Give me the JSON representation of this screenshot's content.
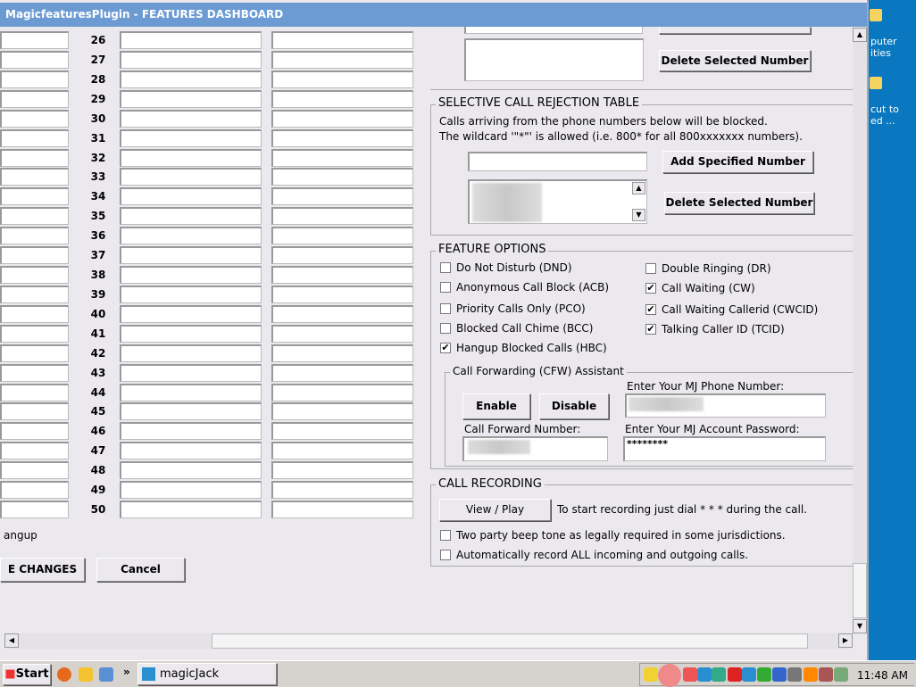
{
  "window": {
    "title": "MagicfeaturesPlugin - FEATURES DASHBOARD"
  },
  "table": {
    "row_numbers": [
      "26",
      "27",
      "28",
      "29",
      "30",
      "31",
      "32",
      "33",
      "34",
      "35",
      "36",
      "37",
      "38",
      "39",
      "40",
      "41",
      "42",
      "43",
      "44",
      "45",
      "46",
      "47",
      "48",
      "49",
      "50"
    ]
  },
  "left_footer": {
    "hangup_label": "angup",
    "save_label": "E CHANGES",
    "cancel_label": "Cancel"
  },
  "top_section": {
    "delete_label": "Delete Selected Number"
  },
  "rejection": {
    "title": "SELECTIVE CALL REJECTION TABLE",
    "line1": "Calls arriving from the phone numbers below will be blocked.",
    "line2": "The wildcard '\"*\"' is allowed (i.e. 800* for all 800xxxxxxx numbers).",
    "add_label": "Add Specified Number",
    "delete_label": "Delete Selected Number"
  },
  "features": {
    "title": "FEATURE OPTIONS",
    "left": [
      {
        "label": "Do Not Disturb (DND)",
        "checked": false
      },
      {
        "label": "Anonymous Call Block (ACB)",
        "checked": false
      },
      {
        "label": "Priority Calls Only (PCO)",
        "checked": false
      },
      {
        "label": "Blocked Call Chime (BCC)",
        "checked": false
      },
      {
        "label": "Hangup Blocked Calls (HBC)",
        "checked": true
      }
    ],
    "right": [
      {
        "label": "Double Ringing (DR)",
        "checked": false
      },
      {
        "label": "Call Waiting (CW)",
        "checked": true
      },
      {
        "label": "Call Waiting Callerid (CWCID)",
        "checked": true
      },
      {
        "label": "Talking Caller ID (TCID)",
        "checked": true
      }
    ]
  },
  "cfw": {
    "title": "Call Forwarding (CFW) Assistant",
    "enable": "Enable",
    "disable": "Disable",
    "phone_label": "Enter Your MJ Phone Number:",
    "forward_label": "Call Forward Number:",
    "password_label": "Enter Your MJ Account Password:",
    "password_value": "********"
  },
  "recording": {
    "title": "CALL RECORDING",
    "view_play": "View / Play",
    "hint": "To start recording just dial  * * *  during the call.",
    "opt1": "Two party beep tone as legally required in some jurisdictions.",
    "opt2": "Automatically record ALL incoming and outgoing calls."
  },
  "desktop": {
    "icon1": "puter\nities",
    "icon2": "cut to\ned ..."
  },
  "taskbar": {
    "start": "Start",
    "app": "magicJack",
    "clock": "11:48 AM"
  }
}
